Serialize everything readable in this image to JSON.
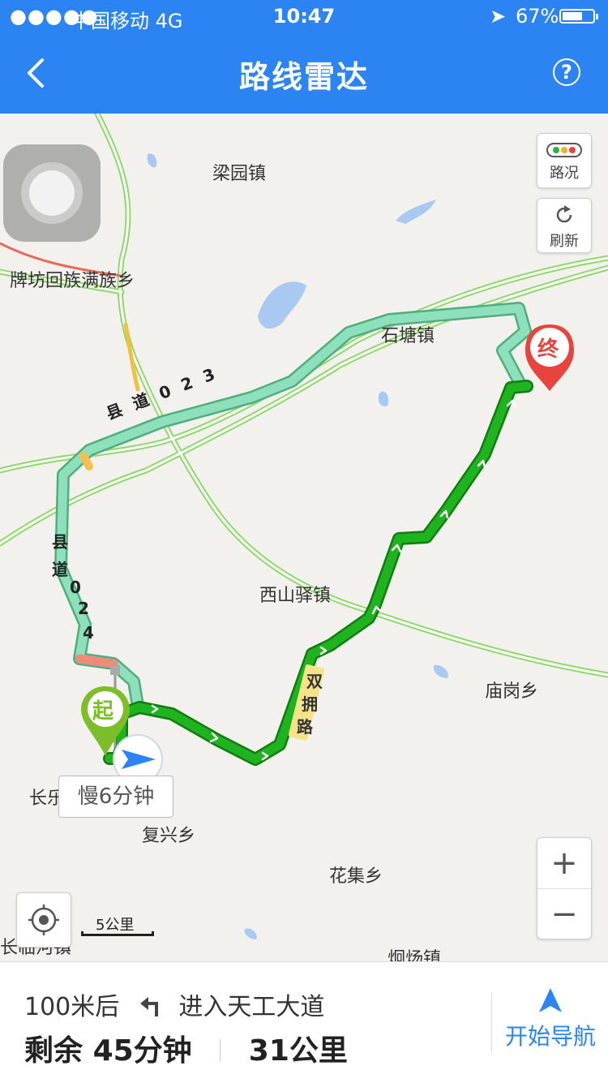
{
  "status_bar": {
    "signal": "●●●●●",
    "carrier": "中国移动  4G",
    "time": "10:47",
    "location_glyph": "➤",
    "battery": "67%",
    "battery_level": 0.67
  },
  "header": {
    "title": "路线雷达",
    "help_glyph": "?"
  },
  "map": {
    "places": {
      "liangyuan": "梁园镇",
      "paifang": "牌坊回族满族乡",
      "shitang": "石塘镇",
      "xishanyi": "西山驿镇",
      "miaogang": "庙岗乡",
      "changle": "长乐",
      "fuxing": "复兴乡",
      "huaji": "花集乡",
      "changlin": "长临河镇",
      "tongyang": "炯炀镇"
    },
    "road_labels": {
      "county_023": "县 道 0 2 3",
      "county_024_chars": [
        "县",
        "道",
        "0",
        "2",
        "4"
      ],
      "shuangyong_chars": [
        "双",
        "拥",
        "路"
      ]
    },
    "start_marker": "起",
    "end_marker": "终",
    "delay_label": "慢6分钟",
    "traffic_button": "路况",
    "refresh_button": "刷新",
    "zoom_in": "+",
    "zoom_out": "−",
    "scale_label": "5公里"
  },
  "bottom": {
    "distance_prompt": "100米后",
    "instruction": "进入天工大道",
    "remaining_label": "剩余",
    "remaining_time": "45分钟",
    "remaining_distance": "31公里",
    "start_nav": "开始导航"
  },
  "colors": {
    "primary": "#2b84f2",
    "route_green": "#1aa31a",
    "route_light": "#7fd8b0",
    "road": "#8fd96c"
  }
}
